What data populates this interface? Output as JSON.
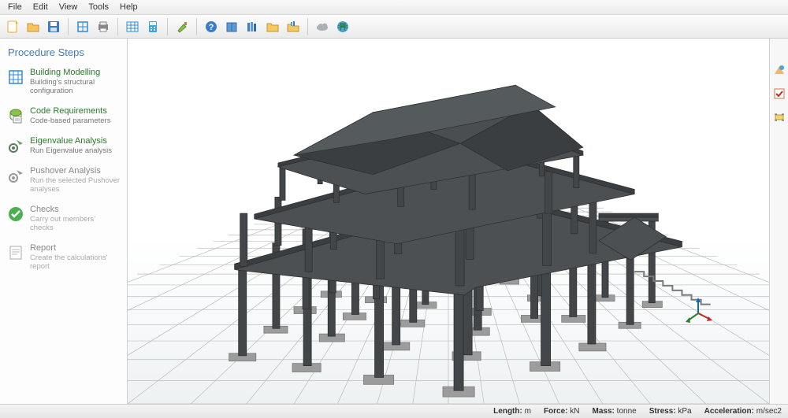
{
  "menu": {
    "file": "File",
    "edit": "Edit",
    "view": "View",
    "tools": "Tools",
    "help": "Help"
  },
  "sidebar": {
    "title": "Procedure Steps",
    "steps": [
      {
        "title": "Building Modelling",
        "desc": "Building's structural configuration"
      },
      {
        "title": "Code Requirements",
        "desc": "Code-based parameters"
      },
      {
        "title": "Eigenvalue Analysis",
        "desc": "Run Eigenvalue analysis"
      },
      {
        "title": "Pushover Analysis",
        "desc": "Run the selected Pushover analyses"
      },
      {
        "title": "Checks",
        "desc": "Carry out members' checks"
      },
      {
        "title": "Report",
        "desc": "Create the calculations' report"
      }
    ]
  },
  "status": {
    "length_lbl": "Length:",
    "length_val": "m",
    "force_lbl": "Force:",
    "force_val": "kN",
    "mass_lbl": "Mass:",
    "mass_val": "tonne",
    "stress_lbl": "Stress:",
    "stress_val": "kPa",
    "accel_lbl": "Acceleration:",
    "accel_val": "m/sec2"
  }
}
